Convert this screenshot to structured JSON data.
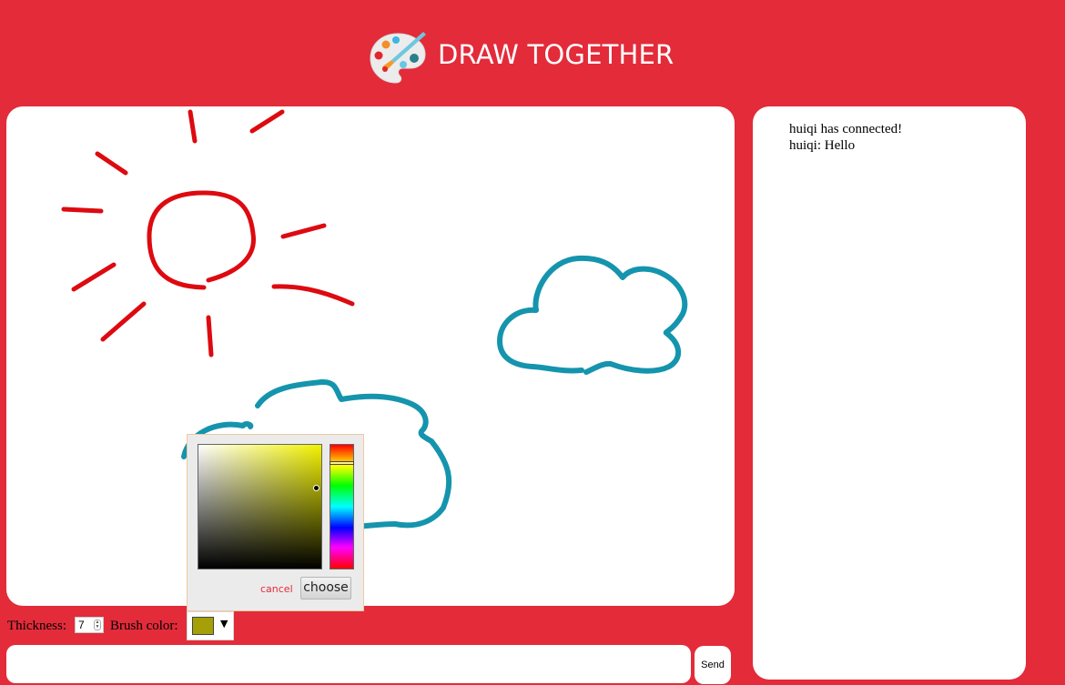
{
  "app": {
    "title": "DRAW TOGETHER",
    "logo_icon": "palette-icon"
  },
  "chat": {
    "messages": [
      "huiqi has connected!",
      "huiqi: Hello"
    ]
  },
  "controls": {
    "thickness_label": "Thickness:",
    "thickness_value": "7",
    "brush_color_label": "Brush color:",
    "brush_color": "#a5a007",
    "dropdown_arrow": "▼"
  },
  "color_picker": {
    "cancel_label": "cancel",
    "choose_label": "choose"
  },
  "message_box": {
    "value": "",
    "send_label": "Send"
  },
  "colors": {
    "background": "#e32b3a",
    "sun_stroke": "#dd0a10",
    "cloud_stroke": "#1594ad"
  }
}
